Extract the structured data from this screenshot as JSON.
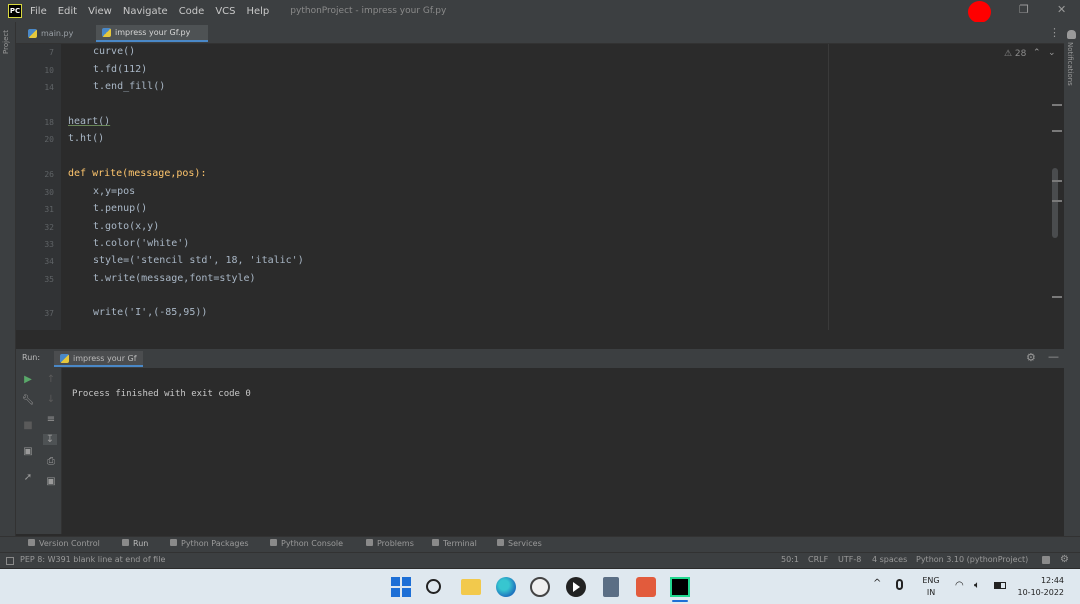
{
  "menubar": {
    "logo": "PC",
    "items": [
      "File",
      "Edit",
      "View",
      "Navigate",
      "Code",
      "VCS",
      "Help"
    ],
    "window_title": "pythonProject - impress your Gf.py"
  },
  "window_controls": {
    "restore": "❐",
    "close": "✕"
  },
  "tool_stripes": {
    "project": "Project",
    "notifications": "Notifications"
  },
  "tabs": [
    {
      "label": "main.py",
      "active": false
    },
    {
      "label": "impress your Gf.py",
      "active": true
    }
  ],
  "editor": {
    "menu_glyph": "⋮",
    "warnings": "⚠ 28",
    "lines": [
      {
        "num": "7",
        "text": "curve()"
      },
      {
        "num": "10",
        "text": "t.fd(112)"
      },
      {
        "num": "14",
        "text": "t.end_fill()"
      },
      {
        "num": "",
        "text": ""
      },
      {
        "num": "18",
        "text": "heart()"
      },
      {
        "num": "20",
        "text": "t.ht()"
      },
      {
        "num": "",
        "text": ""
      },
      {
        "num": "26",
        "text": "def write(message,pos):"
      },
      {
        "num": "30",
        "text": "x,y=pos"
      },
      {
        "num": "31",
        "text": "t.penup()"
      },
      {
        "num": "32",
        "text": "t.goto(x,y)"
      },
      {
        "num": "33",
        "text": "t.color('white')"
      },
      {
        "num": "34",
        "text": "style=('stencil std', 18, 'italic')"
      },
      {
        "num": "35",
        "text": "t.write(message,font=style)"
      },
      {
        "num": "",
        "text": ""
      },
      {
        "num": "37",
        "text": "write('I',(-85,95))"
      }
    ]
  },
  "run_panel": {
    "label": "Run:",
    "tab": "impress your Gf",
    "settings_glyph": "⚙",
    "minimize_glyph": "—",
    "output": "Process finished with exit code 0"
  },
  "toolwindows": [
    "Version Control",
    "Run",
    "Python Packages",
    "Python Console",
    "Problems",
    "Terminal",
    "Services"
  ],
  "statusbar": {
    "message": "PEP 8: W391 blank line at end of file",
    "position": "50:1",
    "line_sep": "CRLF",
    "encoding": "UTF-8",
    "indent": "4 spaces",
    "interpreter": "Python 3.10 (pythonProject)",
    "gear": "⚙"
  },
  "taskbar": {
    "lang_top": "ENG",
    "lang_bottom": "IN",
    "time": "12:44",
    "date": "10-10-2022",
    "tray_up": "^",
    "wifi": "◠",
    "volume": "🔈︎"
  },
  "colors": {
    "background": "#2b2b2b",
    "panel": "#3c3f41",
    "accent": "#4a88c7",
    "record": "#ff0000",
    "taskbar": "#dfe8ef"
  }
}
